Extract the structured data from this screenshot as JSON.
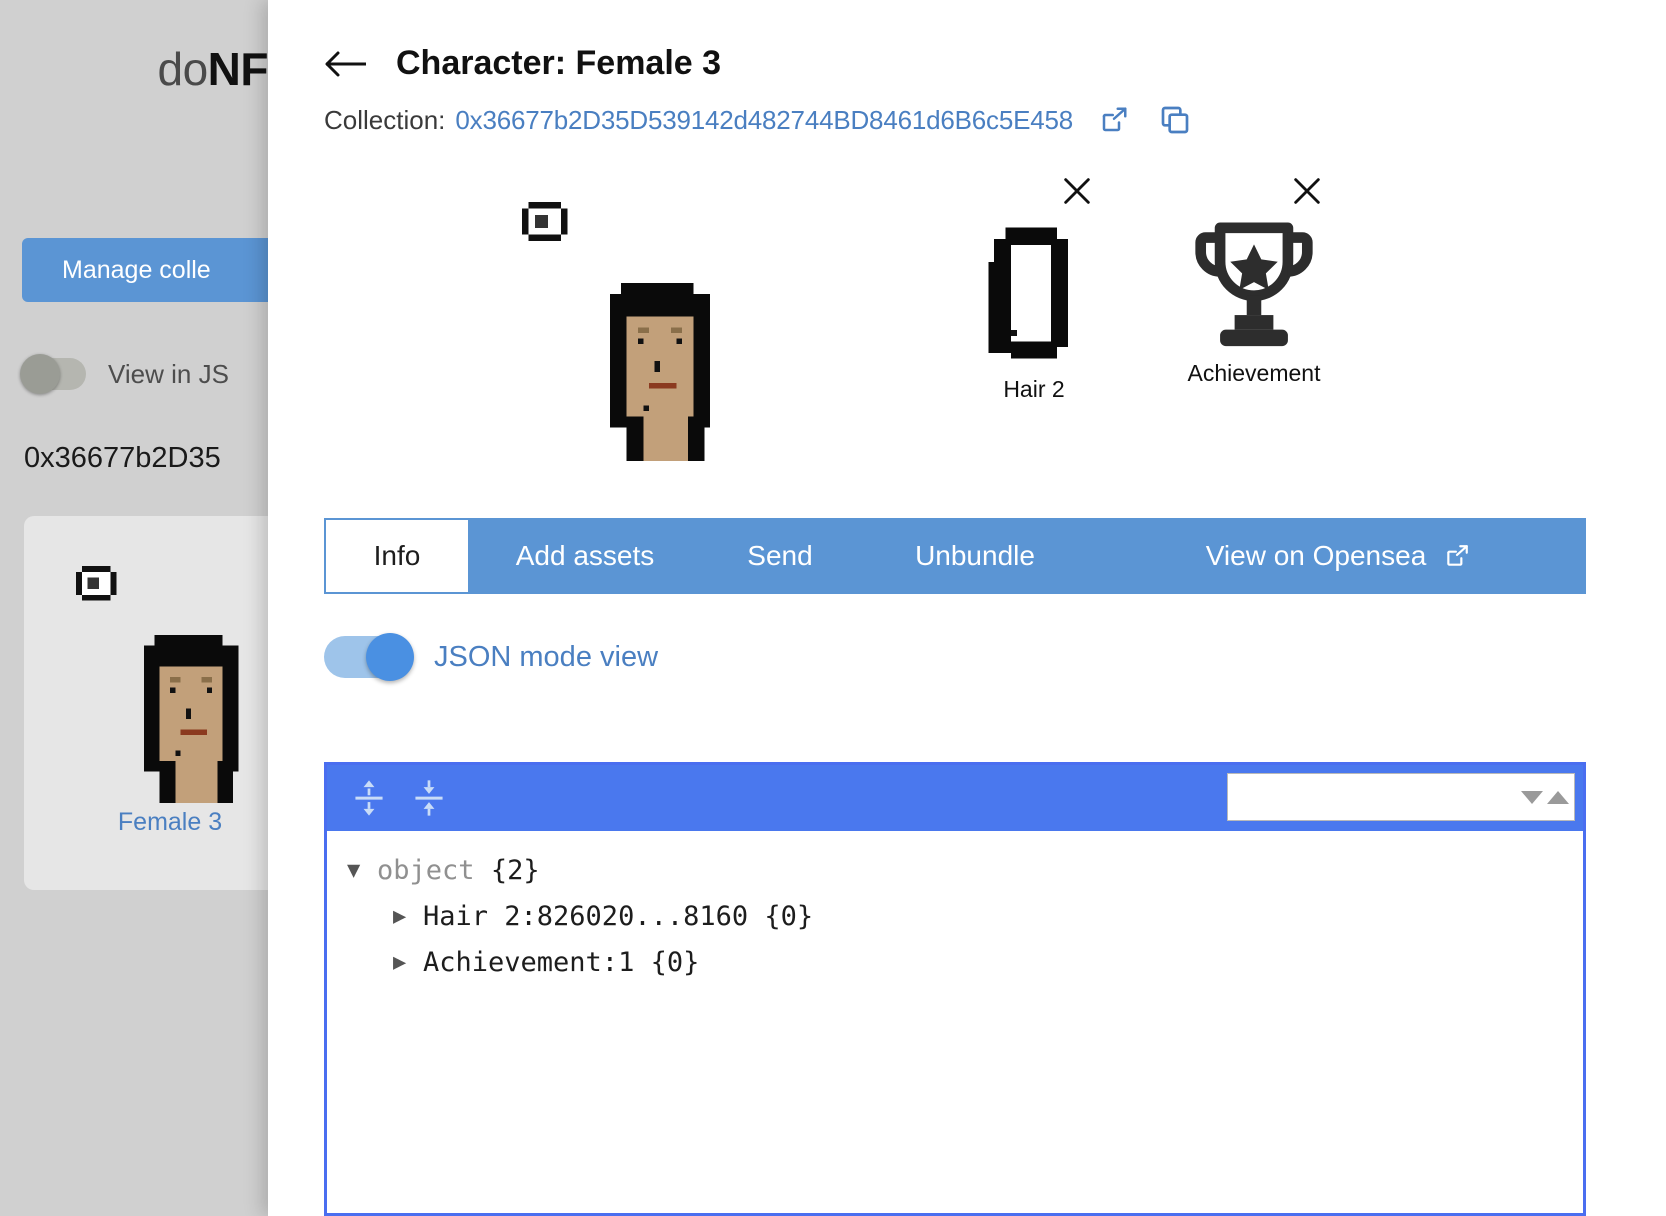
{
  "background": {
    "brand_prefix": "do",
    "brand_suffix": "NF",
    "manage_button": "Manage colle",
    "view_json_toggle_label": "View in JS",
    "wallet_address_truncated": "0x36677b2D35",
    "card": {
      "label": "Female 3"
    }
  },
  "modal": {
    "back_icon": "arrow-left-icon",
    "title": "Character: Female 3",
    "collection_label": "Collection:",
    "collection_address": "0x36677b2D35D539142d482744BD8461d6B6c5E458",
    "external_link_icon": "external-link-icon",
    "copy_icon": "copy-icon",
    "assets": [
      {
        "name": "Female 3",
        "caption": "",
        "removable": false,
        "icon": "character-pixel-art"
      },
      {
        "name": "Hair 2",
        "caption": "Hair 2",
        "removable": true,
        "icon": "hair-pixel-art",
        "remove_icon": "close-icon"
      },
      {
        "name": "Achievement",
        "caption": "Achievement",
        "removable": true,
        "icon": "trophy-icon",
        "remove_icon": "close-icon"
      }
    ],
    "tabs": [
      {
        "label": "Info",
        "active": true
      },
      {
        "label": "Add assets",
        "active": false
      },
      {
        "label": "Send",
        "active": false
      },
      {
        "label": "Unbundle",
        "active": false
      },
      {
        "label": "View on Opensea",
        "active": false,
        "icon": "external-link-icon"
      }
    ],
    "json_mode": {
      "label": "JSON mode view",
      "enabled": true
    },
    "json_viewer": {
      "expand_all_icon": "expand-all-icon",
      "collapse_all_icon": "collapse-all-icon",
      "search_icon": "search-icon",
      "search_value": "",
      "search_placeholder": "",
      "nav_next_icon": "triangle-down-icon",
      "nav_prev_icon": "triangle-up-icon",
      "rows": [
        {
          "level": 0,
          "caret": "▼",
          "key": "object",
          "count": "{2}",
          "key_color": "gray"
        },
        {
          "level": 1,
          "caret": "▶",
          "key": "Hair 2:826020...8160",
          "count": "{0}",
          "key_color": "dark"
        },
        {
          "level": 1,
          "caret": "▶",
          "key": "Achievement:1",
          "count": "{0}",
          "key_color": "dark"
        }
      ]
    }
  },
  "colors": {
    "accent_blue": "#5b95d4",
    "link_blue": "#4a7fc1",
    "viewer_blue": "#4a78ee",
    "toggle_on": "#4a90e2",
    "page_gray": "#d0d0d0"
  }
}
